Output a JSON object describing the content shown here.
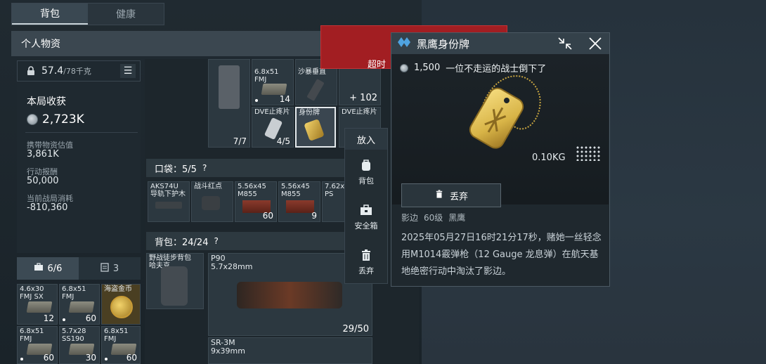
{
  "tabs": [
    {
      "label": "背包",
      "active": true
    },
    {
      "label": "健康",
      "active": false
    }
  ],
  "section_title": "个人物资",
  "weight": {
    "value": "57.4",
    "max": "/78千克"
  },
  "earnings": {
    "title": "本局收获",
    "value": "2,723K",
    "stats": [
      {
        "label": "携带物资估值",
        "value": "3,861K"
      },
      {
        "label": "行动报酬",
        "value": "50,000"
      },
      {
        "label": "当前战局消耗",
        "value": "-810,360"
      }
    ]
  },
  "left_tabs": [
    {
      "label": "6/6",
      "icon": "toolbox-icon"
    },
    {
      "label": "3",
      "icon": "clipboard-icon"
    }
  ],
  "secure_items": [
    {
      "label": "4.6x30\nFMJ SX",
      "count": "12",
      "dot": false
    },
    {
      "label": "6.8x51\nFMJ",
      "count": "60",
      "dot": true
    },
    {
      "label": "海盗金币",
      "count": "",
      "dot": false
    },
    {
      "label": "6.8x51\nFMJ",
      "count": "60",
      "dot": true
    },
    {
      "label": "5.7x28\nSS190",
      "count": "30",
      "dot": false
    },
    {
      "label": "6.8x51\nFMJ",
      "count": "60",
      "dot": true
    }
  ],
  "top_items": [
    {
      "label": "",
      "count": "7/7"
    },
    {
      "label": "6.8x51\nFMJ",
      "count": "14",
      "top": "25"
    },
    {
      "label": "沙暴垂直",
      "count": ""
    },
    {
      "label": "",
      "count": "+ 102"
    },
    {
      "label": "DVE止疼片",
      "count": "4/5"
    },
    {
      "label": "身份牌",
      "count": ""
    },
    {
      "label": "DVE止疼片",
      "count": ""
    }
  ],
  "pocket": {
    "title": "口袋：5/5",
    "items": [
      {
        "label": "AKS74U\n导轨下护木",
        "count": ""
      },
      {
        "label": "战斗红点",
        "count": ""
      },
      {
        "label": "5.56x45\nM855",
        "count": "60"
      },
      {
        "label": "5.56x45\nM855",
        "count": "9"
      },
      {
        "label": "7.62x\nPS",
        "count": ""
      }
    ]
  },
  "backpack": {
    "title": "背包：24/24",
    "bag": {
      "label": "野战徒步背包\n哈夫克"
    },
    "weapons": [
      {
        "name": "P90",
        "caliber": "5.7x28mm",
        "count": "29/50"
      },
      {
        "name": "SR-3M",
        "caliber": "9x39mm",
        "count": ""
      }
    ]
  },
  "red_notice": {
    "text": "超时"
  },
  "context_menu": {
    "header": "放入",
    "items": [
      {
        "label": "背包",
        "icon": "backpack-icon"
      },
      {
        "label": "安全箱",
        "icon": "safe-box-icon"
      },
      {
        "label": "丢弃",
        "icon": "trash-icon"
      }
    ]
  },
  "detail": {
    "title": "黑鹰身份牌",
    "value": "1,500",
    "tagline": "一位不走运的战士倒下了",
    "weight": "0.10KG",
    "discard_label": "丢弃",
    "owner_name": "影边",
    "owner_level": "60级",
    "owner_class": "黑鹰",
    "description": "2025年05月27日16时21分17秒，赌她一丝轻念用M1014霰弹枪（12 Gauge 龙息弹）在航天基地绝密行动中淘汰了影边。"
  },
  "colors": {
    "accent_red": "#a21e22",
    "panel": "#1f282e",
    "gold": "#d8b447"
  }
}
